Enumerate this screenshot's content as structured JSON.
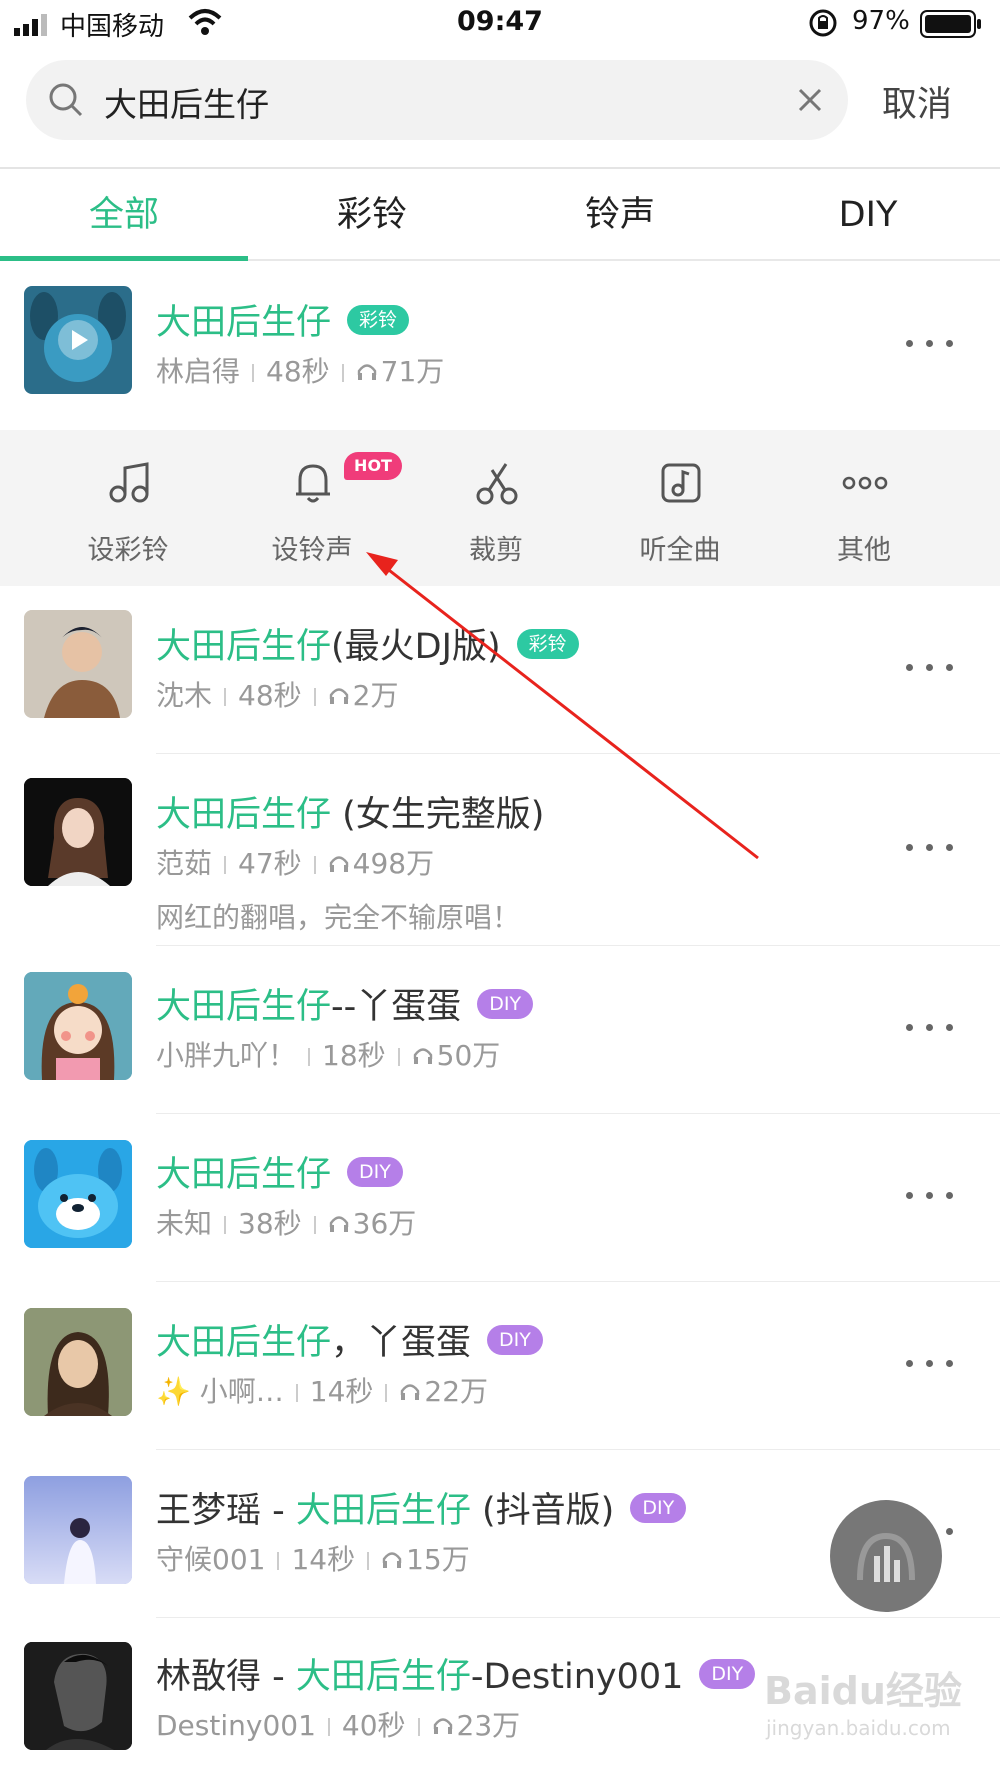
{
  "status_bar": {
    "carrier": "中国移动",
    "time": "09:47",
    "battery": "97%"
  },
  "search": {
    "query": "大田后生仔",
    "cancel_label": "取消"
  },
  "tabs": [
    {
      "label": "全部",
      "active": true
    },
    {
      "label": "彩铃",
      "active": false
    },
    {
      "label": "铃声",
      "active": false
    },
    {
      "label": "DIY",
      "active": false
    }
  ],
  "actions": [
    {
      "label": "设彩铃",
      "icon": "music-note-icon"
    },
    {
      "label": "设铃声",
      "icon": "bell-icon",
      "badge": "HOT"
    },
    {
      "label": "裁剪",
      "icon": "scissors-icon"
    },
    {
      "label": "听全曲",
      "icon": "music-file-icon"
    },
    {
      "label": "其他",
      "icon": "more-dots-icon"
    }
  ],
  "results": [
    {
      "title_pre": "",
      "title_hl": "大田后生仔",
      "title_post": "",
      "badge": "彩铃",
      "artist": "林启得",
      "duration": "48秒",
      "plays": "71万",
      "desc": ""
    },
    {
      "title_pre": "",
      "title_hl": "大田后生仔",
      "title_post": "(最火DJ版)",
      "badge": "彩铃",
      "artist": "沈木",
      "duration": "48秒",
      "plays": "2万",
      "desc": ""
    },
    {
      "title_pre": "",
      "title_hl": "大田后生仔",
      "title_post": " (女生完整版)",
      "badge": "",
      "artist": "范茹",
      "duration": "47秒",
      "plays": "498万",
      "desc": "网红的翻唱，完全不输原唱！"
    },
    {
      "title_pre": "",
      "title_hl": "大田后生仔",
      "title_post": "--丫蛋蛋",
      "badge": "DIY",
      "artist": "小胖九吖！",
      "duration": "18秒",
      "plays": "50万",
      "desc": ""
    },
    {
      "title_pre": "",
      "title_hl": "大田后生仔",
      "title_post": "",
      "badge": "DIY",
      "artist": "未知",
      "duration": "38秒",
      "plays": "36万",
      "desc": ""
    },
    {
      "title_pre": "",
      "title_hl": "大田后生仔",
      "title_post": "，丫蛋蛋",
      "badge": "DIY",
      "artist": "✨ 小啊…",
      "duration": "14秒",
      "plays": "22万",
      "desc": ""
    },
    {
      "title_pre": "王梦瑶 - ",
      "title_hl": "大田后生仔",
      "title_post": " (抖音版)",
      "badge": "DIY",
      "artist": "守候001",
      "duration": "14秒",
      "plays": "15万",
      "desc": ""
    },
    {
      "title_pre": "林敔得 - ",
      "title_hl": "大田后生仔",
      "title_post": "-Destiny001",
      "badge": "DIY",
      "artist": "Destiny001",
      "duration": "40秒",
      "plays": "23万",
      "desc": ""
    }
  ],
  "watermark": {
    "text": "Baidu经验",
    "url": "jingyan.baidu.com"
  },
  "colors": {
    "accent": "#2cbe87",
    "badge_cl": "#2dc9a2",
    "badge_diy": "#b57fe8",
    "hot": "#f03c7a"
  }
}
